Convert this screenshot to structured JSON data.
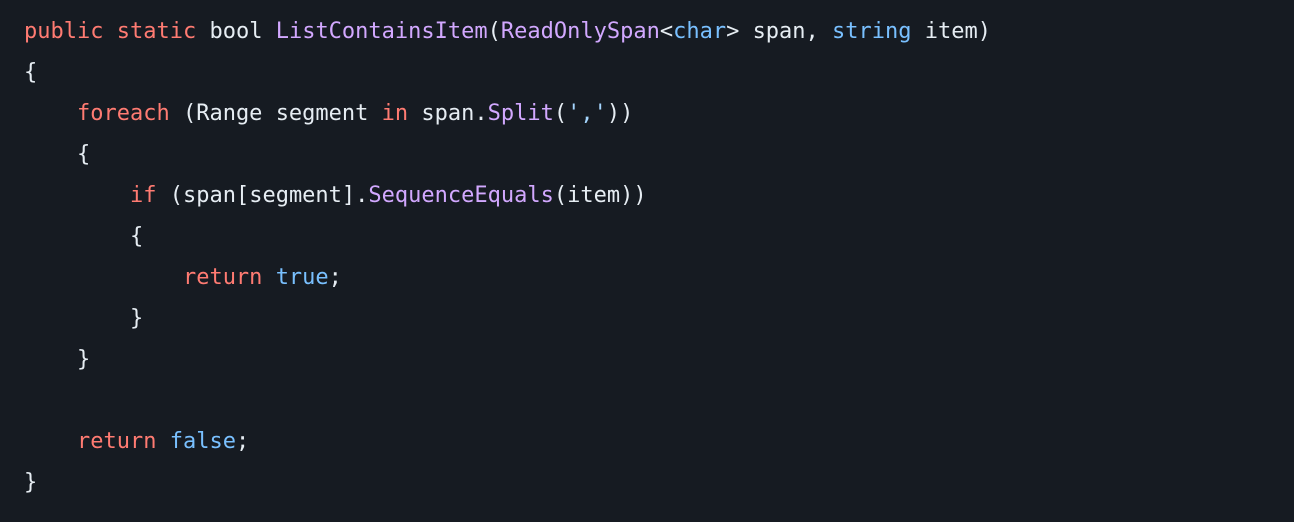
{
  "code": {
    "lines": [
      [
        {
          "cls": "tok-kw",
          "t": "public"
        },
        {
          "cls": "tok-punct",
          "t": " "
        },
        {
          "cls": "tok-kw",
          "t": "static"
        },
        {
          "cls": "tok-punct",
          "t": " "
        },
        {
          "cls": "tok-type",
          "t": "bool"
        },
        {
          "cls": "tok-punct",
          "t": " "
        },
        {
          "cls": "tok-typefn",
          "t": "ListContainsItem"
        },
        {
          "cls": "tok-punct",
          "t": "("
        },
        {
          "cls": "tok-typefn",
          "t": "ReadOnlySpan"
        },
        {
          "cls": "tok-punct",
          "t": "<"
        },
        {
          "cls": "tok-builtin",
          "t": "char"
        },
        {
          "cls": "tok-punct",
          "t": "> "
        },
        {
          "cls": "tok-ident",
          "t": "span"
        },
        {
          "cls": "tok-punct",
          "t": ", "
        },
        {
          "cls": "tok-builtin",
          "t": "string"
        },
        {
          "cls": "tok-punct",
          "t": " "
        },
        {
          "cls": "tok-ident",
          "t": "item"
        },
        {
          "cls": "tok-punct",
          "t": ")"
        }
      ],
      [
        {
          "cls": "tok-punct",
          "t": "{"
        }
      ],
      [
        {
          "cls": "tok-punct",
          "t": "    "
        },
        {
          "cls": "tok-kw",
          "t": "foreach"
        },
        {
          "cls": "tok-punct",
          "t": " ("
        },
        {
          "cls": "tok-type",
          "t": "Range"
        },
        {
          "cls": "tok-punct",
          "t": " "
        },
        {
          "cls": "tok-ident",
          "t": "segment"
        },
        {
          "cls": "tok-punct",
          "t": " "
        },
        {
          "cls": "tok-kw",
          "t": "in"
        },
        {
          "cls": "tok-punct",
          "t": " "
        },
        {
          "cls": "tok-ident",
          "t": "span"
        },
        {
          "cls": "tok-punct",
          "t": "."
        },
        {
          "cls": "tok-typefn",
          "t": "Split"
        },
        {
          "cls": "tok-punct",
          "t": "("
        },
        {
          "cls": "tok-str",
          "t": "','"
        },
        {
          "cls": "tok-punct",
          "t": "))"
        }
      ],
      [
        {
          "cls": "tok-punct",
          "t": "    {"
        }
      ],
      [
        {
          "cls": "tok-punct",
          "t": "        "
        },
        {
          "cls": "tok-kw",
          "t": "if"
        },
        {
          "cls": "tok-punct",
          "t": " ("
        },
        {
          "cls": "tok-ident",
          "t": "span"
        },
        {
          "cls": "tok-punct",
          "t": "["
        },
        {
          "cls": "tok-ident",
          "t": "segment"
        },
        {
          "cls": "tok-punct",
          "t": "]."
        },
        {
          "cls": "tok-typefn",
          "t": "SequenceEquals"
        },
        {
          "cls": "tok-punct",
          "t": "("
        },
        {
          "cls": "tok-ident",
          "t": "item"
        },
        {
          "cls": "tok-punct",
          "t": "))"
        }
      ],
      [
        {
          "cls": "tok-punct",
          "t": "        {"
        }
      ],
      [
        {
          "cls": "tok-punct",
          "t": "            "
        },
        {
          "cls": "tok-kw",
          "t": "return"
        },
        {
          "cls": "tok-punct",
          "t": " "
        },
        {
          "cls": "tok-builtin",
          "t": "true"
        },
        {
          "cls": "tok-punct",
          "t": ";"
        }
      ],
      [
        {
          "cls": "tok-punct",
          "t": "        }"
        }
      ],
      [
        {
          "cls": "tok-punct",
          "t": "    }"
        }
      ],
      [
        {
          "cls": "tok-punct",
          "t": ""
        }
      ],
      [
        {
          "cls": "tok-punct",
          "t": "    "
        },
        {
          "cls": "tok-kw",
          "t": "return"
        },
        {
          "cls": "tok-punct",
          "t": " "
        },
        {
          "cls": "tok-builtin",
          "t": "false"
        },
        {
          "cls": "tok-punct",
          "t": ";"
        }
      ],
      [
        {
          "cls": "tok-punct",
          "t": "}"
        }
      ]
    ]
  }
}
